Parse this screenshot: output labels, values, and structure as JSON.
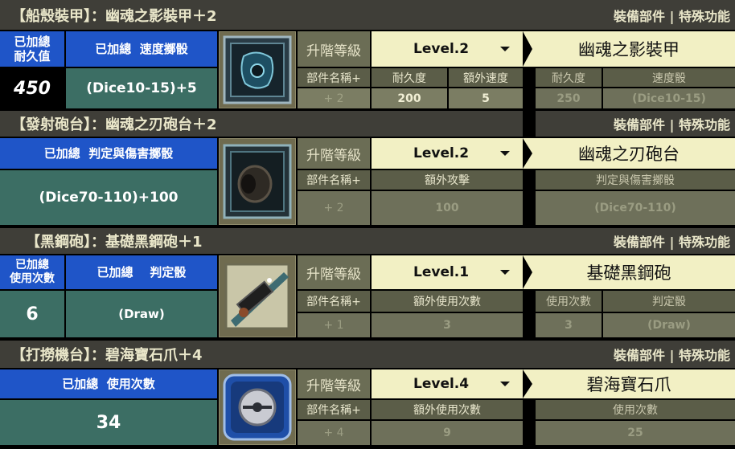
{
  "right_header": "裝備部件 | 特殊功能",
  "upgrade_label": "升階等級",
  "sections": [
    {
      "title": "【船殼裝甲】：幽魂之影裝甲＋2",
      "left_h1": "已加總\n耐久值",
      "left_h2": "已加總  速度擲骰",
      "left_v1": "450",
      "left_v2": "(Dice10-15)+5",
      "level": "Level.2",
      "part_name": "幽魂之影裝甲",
      "mid_headers": [
        "部件名稱+",
        "耐久度",
        "額外速度"
      ],
      "mid_values": [
        "+ 2",
        "200",
        "5"
      ],
      "right_headers": [
        "耐久度",
        "速度骰"
      ],
      "right_values": [
        "250",
        "(Dice10-15)"
      ]
    },
    {
      "title": "【發射砲台】：幽魂之刃砲台＋2",
      "left_h": "已加總  判定與傷害擲骰",
      "left_v": "(Dice70-110)+100",
      "level": "Level.2",
      "part_name": "幽魂之刃砲台",
      "mid_headers": [
        "部件名稱+",
        "額外攻擊"
      ],
      "mid_values": [
        "+ 2",
        "100"
      ],
      "right_headers": [
        "判定與傷害擲骰"
      ],
      "right_values": [
        "(Dice70-110)"
      ]
    },
    {
      "title": "【黑鋼砲】：基礎黑鋼砲＋1",
      "left_h1": "已加總\n使用次數",
      "left_h2": "已加總    判定骰",
      "left_v1": "6",
      "left_v2": "(Draw)",
      "level": "Level.1",
      "part_name": "基礎黑鋼砲",
      "mid_headers": [
        "部件名稱+",
        "額外使用次數"
      ],
      "mid_values": [
        "+ 1",
        "3"
      ],
      "right_headers": [
        "使用次數",
        "判定骰"
      ],
      "right_values": [
        "3",
        "(Draw)"
      ]
    },
    {
      "title": "【打撈機台】：碧海寶石爪＋4",
      "left_h": "已加總  使用次數",
      "left_v": "34",
      "level": "Level.4",
      "part_name": "碧海寶石爪",
      "mid_headers": [
        "部件名稱+",
        "額外使用次數"
      ],
      "mid_values": [
        "+ 4",
        "9"
      ],
      "right_headers": [
        "使用次數"
      ],
      "right_values": [
        "25"
      ]
    }
  ],
  "icons": [
    "ghost-armor-icon",
    "ghost-cannon-icon",
    "black-steel-cannon-icon",
    "gem-claw-icon"
  ],
  "colors": {
    "header_bg": "#3f3e38",
    "blue": "#1f55c8",
    "teal": "#3c6e64",
    "cream": "#f2f0c4",
    "olive": "#6b6d55"
  }
}
